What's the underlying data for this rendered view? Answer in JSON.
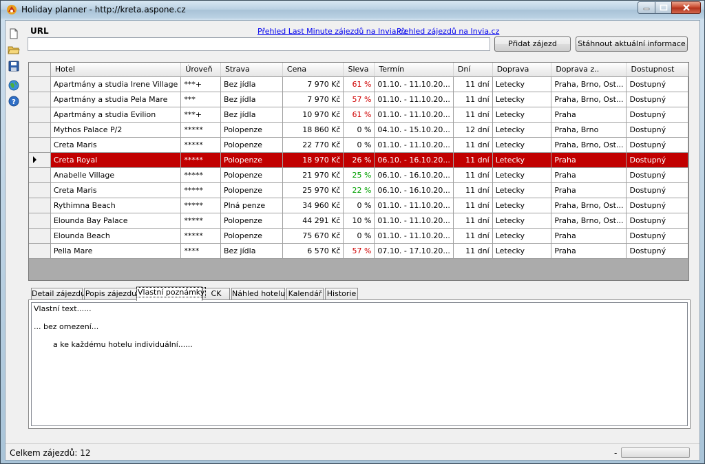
{
  "window": {
    "title": "Holiday planner - http://kreta.aspone.cz"
  },
  "toolbar": {
    "icons": [
      "new-file-icon",
      "open-folder-icon",
      "save-icon",
      "globe-icon",
      "help-icon"
    ]
  },
  "url": {
    "label": "URL",
    "value": ""
  },
  "links": {
    "last_minute": "Přehled Last Minute zájezdů na Invia.cz",
    "zajezdy": "Přehled zájezdů na Invia.cz"
  },
  "buttons": {
    "add": "Přidat zájezd",
    "download": "Stáhnout aktuální informace"
  },
  "grid": {
    "columns": [
      "Hotel",
      "Úroveň",
      "Strava",
      "Cena",
      "Sleva",
      "Termín",
      "Dní",
      "Doprava",
      "Doprava z..",
      "Dostupnost"
    ],
    "selected_index": 5,
    "rows": [
      {
        "hotel": "Apartmány a studia Irene Village",
        "uroven": "***+",
        "strava": "Bez jídla",
        "cena": "7 970 Kč",
        "sleva": "61 %",
        "sleva_color": "red",
        "termin": "01.10. - 11.10.20...",
        "dni": "11 dní",
        "doprava": "Letecky",
        "doprava_z": "Praha, Brno, Ost...",
        "dostupnost": "Dostupný"
      },
      {
        "hotel": "Apartmány a studia Pela Mare",
        "uroven": "***",
        "strava": "Bez jídla",
        "cena": "7 970 Kč",
        "sleva": "57 %",
        "sleva_color": "red",
        "termin": "01.10. - 11.10.20...",
        "dni": "11 dní",
        "doprava": "Letecky",
        "doprava_z": "Praha, Brno, Ost...",
        "dostupnost": "Dostupný"
      },
      {
        "hotel": "Apartmány a studia Evilion",
        "uroven": "***+",
        "strava": "Bez jídla",
        "cena": "10 970 Kč",
        "sleva": "61 %",
        "sleva_color": "red",
        "termin": "01.10. - 11.10.20...",
        "dni": "11 dní",
        "doprava": "Letecky",
        "doprava_z": "Praha",
        "dostupnost": "Dostupný"
      },
      {
        "hotel": "Mythos Palace P/2",
        "uroven": "*****",
        "strava": "Polopenze",
        "cena": "18 860 Kč",
        "sleva": "0 %",
        "sleva_color": "black",
        "termin": "04.10. - 15.10.20...",
        "dni": "12 dní",
        "doprava": "Letecky",
        "doprava_z": "Praha, Brno",
        "dostupnost": "Dostupný"
      },
      {
        "hotel": "Creta Maris",
        "uroven": "*****",
        "strava": "Polopenze",
        "cena": "22 770 Kč",
        "sleva": "0 %",
        "sleva_color": "black",
        "termin": "01.10. - 11.10.20...",
        "dni": "11 dní",
        "doprava": "Letecky",
        "doprava_z": "Praha, Brno, Ost...",
        "dostupnost": "Dostupný"
      },
      {
        "hotel": "Creta Royal",
        "uroven": "*****",
        "strava": "Polopenze",
        "cena": "18 970 Kč",
        "sleva": "26 %",
        "sleva_color": "black",
        "termin": "06.10. - 16.10.20...",
        "dni": "11 dní",
        "doprava": "Letecky",
        "doprava_z": "Praha",
        "dostupnost": "Dostupný"
      },
      {
        "hotel": "Anabelle Village",
        "uroven": "*****",
        "strava": "Polopenze",
        "cena": "21 970 Kč",
        "sleva": "25 %",
        "sleva_color": "green",
        "termin": "06.10. - 16.10.20...",
        "dni": "11 dní",
        "doprava": "Letecky",
        "doprava_z": "Praha",
        "dostupnost": "Dostupný"
      },
      {
        "hotel": "Creta Maris",
        "uroven": "*****",
        "strava": "Polopenze",
        "cena": "25 970 Kč",
        "sleva": "22 %",
        "sleva_color": "green",
        "termin": "06.10. - 16.10.20...",
        "dni": "11 dní",
        "doprava": "Letecky",
        "doprava_z": "Praha",
        "dostupnost": "Dostupný"
      },
      {
        "hotel": "Rythimna Beach",
        "uroven": "*****",
        "strava": "Plná penze",
        "cena": "34 960 Kč",
        "sleva": "0 %",
        "sleva_color": "black",
        "termin": "01.10. - 11.10.20...",
        "dni": "11 dní",
        "doprava": "Letecky",
        "doprava_z": "Praha, Brno, Ost...",
        "dostupnost": "Dostupný"
      },
      {
        "hotel": "Elounda Bay Palace",
        "uroven": "*****",
        "strava": "Polopenze",
        "cena": "44 291 Kč",
        "sleva": "10 %",
        "sleva_color": "black",
        "termin": "01.10. - 11.10.20...",
        "dni": "11 dní",
        "doprava": "Letecky",
        "doprava_z": "Praha, Brno, Ost...",
        "dostupnost": "Dostupný"
      },
      {
        "hotel": "Elounda Beach",
        "uroven": "*****",
        "strava": "Polopenze",
        "cena": "75 670 Kč",
        "sleva": "0 %",
        "sleva_color": "black",
        "termin": "01.10. - 11.10.20...",
        "dni": "11 dní",
        "doprava": "Letecky",
        "doprava_z": "Praha",
        "dostupnost": "Dostupný"
      },
      {
        "hotel": "Pella Mare",
        "uroven": "****",
        "strava": "Bez jídla",
        "cena": "6 570 Kč",
        "sleva": "57 %",
        "sleva_color": "red",
        "termin": "07.10. - 17.10.20...",
        "dni": "11 dní",
        "doprava": "Letecky",
        "doprava_z": "Praha",
        "dostupnost": "Dostupný"
      }
    ]
  },
  "tabs": {
    "active_index": 2,
    "items": [
      "Detail zájezdu",
      "Popis zájezdu",
      "Vlastní poznámky",
      "CK",
      "Náhled hotelu",
      "Kalendář",
      "Historie"
    ]
  },
  "notes": {
    "lines": [
      "Vlastní text......",
      "",
      "... bez omezení...",
      "",
      "        a ke každému hotelu individuální......"
    ]
  },
  "status": {
    "text": "Celkem zájezdů: 12",
    "dash": "-",
    "progress": 0
  },
  "colors": {
    "selected_row": "#c10000",
    "discount_red": "#d00000",
    "discount_green": "#00a000",
    "link": "#0000ee"
  }
}
